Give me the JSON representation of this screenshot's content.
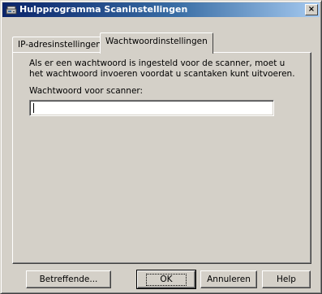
{
  "window": {
    "title": "Hulpprogramma Scaninstellingen",
    "close_glyph": "×",
    "app_icon": "scanner-icon"
  },
  "tabs": [
    {
      "label": "IP-adresinstellingen",
      "active": false
    },
    {
      "label": "Wachtwoordinstellingen",
      "active": true
    }
  ],
  "panel": {
    "description": "Als er een wachtwoord is ingesteld voor de scanner, moet u het wachtwoord invoeren voordat u scantaken kunt uitvoeren.",
    "password_label": "Wachtwoord voor scanner:",
    "password_value": ""
  },
  "buttons": {
    "about": "Betreffende...",
    "ok": "OK",
    "cancel": "Annuleren",
    "help": "Help"
  },
  "colors": {
    "titlebar_start": "#0a246a",
    "titlebar_end": "#a6caf0",
    "face": "#d4d0c8"
  }
}
